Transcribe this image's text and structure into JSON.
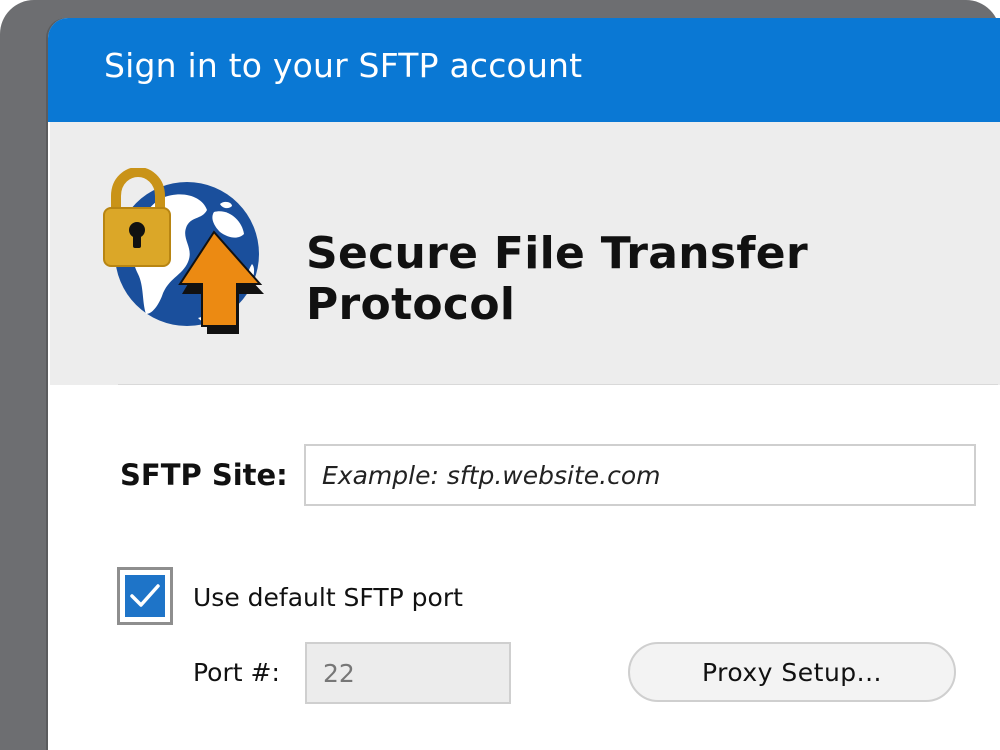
{
  "window": {
    "title": "Sign in to your SFTP account"
  },
  "banner": {
    "heading": "Secure File Transfer Protocol",
    "logo_icon": "lock-globe-upload-icon"
  },
  "form": {
    "site_label": "SFTP Site:",
    "site_placeholder": "Example: sftp.website.com",
    "site_value": "",
    "use_default_port_label": "Use default SFTP port",
    "use_default_port_checked": true,
    "port_label": "Port #:",
    "port_value": "22",
    "proxy_button_label": "Proxy Setup..."
  },
  "colors": {
    "title_bar": "#0a78d4",
    "banner_background": "#ededed",
    "checkbox_fill": "#1e74c8",
    "lock_gold": "#dba728",
    "globe_blue": "#1a4f9c",
    "arrow_orange": "#ec8a12"
  }
}
